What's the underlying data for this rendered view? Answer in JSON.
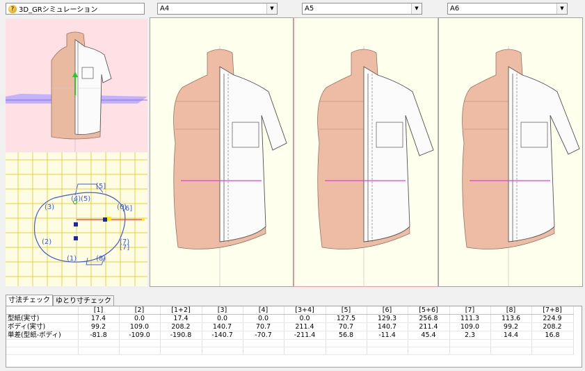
{
  "window": {
    "title": "3D_GRシミュレーション"
  },
  "views": [
    {
      "label": "A4"
    },
    {
      "label": "A5"
    },
    {
      "label": "A6"
    }
  ],
  "grid_labels": [
    "[5]",
    "(4)",
    "(5)",
    "(3)",
    "(6)",
    "[6]",
    "(2)",
    "(7)",
    "[7]",
    "(1)",
    "(8)"
  ],
  "tabs": [
    "寸法チェック",
    "ゆとり寸チェック"
  ],
  "table": {
    "columns": [
      "",
      "[1]",
      "[2]",
      "[1+2]",
      "[3]",
      "[4]",
      "[3+4]",
      "[5]",
      "[6]",
      "[5+6]",
      "[7]",
      "[8]",
      "[7+8]"
    ],
    "rows": [
      {
        "label": "型紙(実寸)",
        "values": [
          "17.4",
          "0.0",
          "17.4",
          "0.0",
          "0.0",
          "0.0",
          "127.5",
          "129.3",
          "256.8",
          "111.3",
          "113.6",
          "224.9"
        ]
      },
      {
        "label": "ボディ(実寸)",
        "values": [
          "99.2",
          "109.0",
          "208.2",
          "140.7",
          "70.7",
          "211.4",
          "70.7",
          "140.7",
          "211.4",
          "109.0",
          "99.2",
          "208.2"
        ]
      },
      {
        "label": "単差(型紙-ボディ)",
        "values": [
          "-81.8",
          "-109.0",
          "-190.8",
          "-140.7",
          "-70.7",
          "-211.4",
          "56.8",
          "-11.4",
          "45.4",
          "2.3",
          "14.4",
          "16.8"
        ]
      }
    ]
  }
}
